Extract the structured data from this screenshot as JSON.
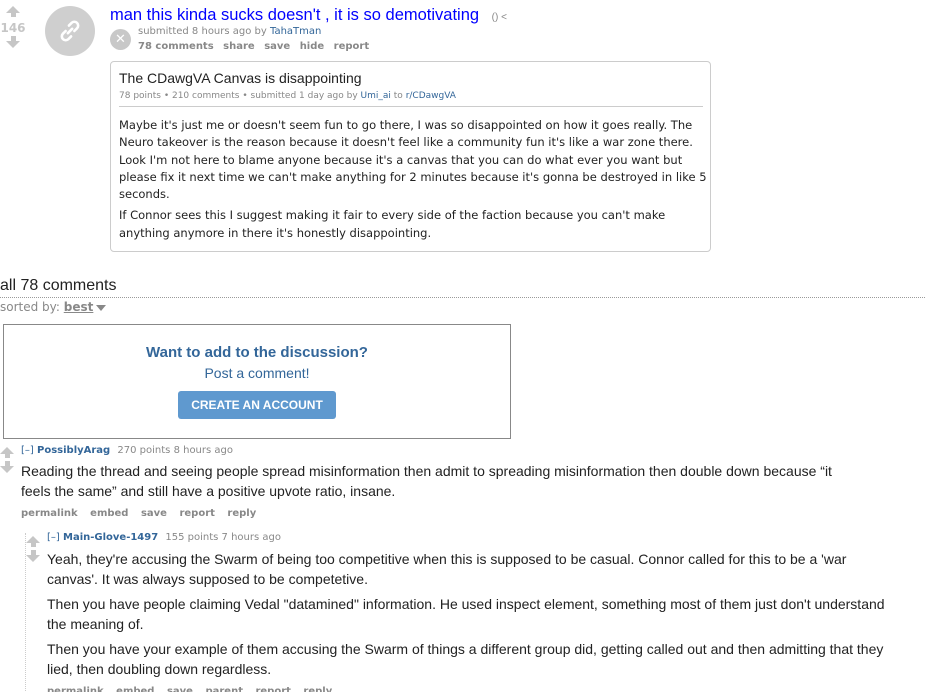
{
  "post": {
    "score": "146",
    "title": "man this kinda sucks doesn't , it is so demotivating",
    "domain_glyph": "() <",
    "submitted_prefix": "submitted 8 hours ago by ",
    "author": "TahaTman",
    "buttons": [
      "78 comments",
      "share",
      "save",
      "hide",
      "report"
    ]
  },
  "crosspost": {
    "title": "The CDawgVA Canvas is disappointing",
    "meta_prefix": "78 points • 210 comments • submitted 1 day ago by ",
    "author": "Umi_ai",
    "to": " to ",
    "subreddit": "r/CDawgVA",
    "paragraphs": [
      "Maybe it's just me or doesn't seem fun to go there, I was so disappointed on how it goes really. The Neuro takeover is the reason because it doesn't feel like a community fun it's like a war zone there. Look I'm not here to blame anyone because it's a canvas that you can do what ever you want but please fix it next time we can't make anything for 2 minutes because it's gonna be destroyed in like 5 seconds.",
      "If Connor sees this I suggest making it fair to every side of the faction because you can't make anything anymore in there it's honestly disappointing."
    ]
  },
  "comments_header": {
    "title": "all 78 comments",
    "sorted_label": "sorted by: ",
    "sort_value": "best"
  },
  "discussion_box": {
    "heading": "Want to add to the discussion?",
    "link": "Post a comment!",
    "button": "CREATE AN ACCOUNT"
  },
  "comments": [
    {
      "expand": "[–]",
      "user": "PossiblyArag",
      "meta": "270 points 8 hours ago",
      "paragraphs": [
        "Reading the thread and seeing people spread misinformation then admit to spreading misinformation then double down because “it feels the same” and still have a positive upvote ratio, insane."
      ],
      "buttons": [
        "permalink",
        "embed",
        "save",
        "report",
        "reply"
      ]
    },
    {
      "expand": "[–]",
      "user": "Main-Glove-1497",
      "meta": "155 points 7 hours ago",
      "paragraphs": [
        "Yeah, they're accusing the Swarm of being too competitive when this is supposed to be casual. Connor called for this to be a 'war canvas'. It was always supposed to be competetive.",
        "Then you have people claiming Vedal \"datamined\" information. He used inspect element, something most of them just don't understand the meaning of.",
        "Then you have your example of them accusing the Swarm of things a different group did, getting called out and then admitting that they lied, then doubling down regardless."
      ],
      "buttons": [
        "permalink",
        "embed",
        "save",
        "parent",
        "report",
        "reply"
      ]
    }
  ],
  "colors": {
    "link": "#0000ff",
    "accent": "#336699",
    "button": "#5f99cf",
    "muted": "#888888"
  },
  "icons": {
    "thumbnail": "link-icon",
    "hide": "close-icon",
    "vote_up": "upvote-arrow-icon",
    "vote_down": "downvote-arrow-icon"
  }
}
